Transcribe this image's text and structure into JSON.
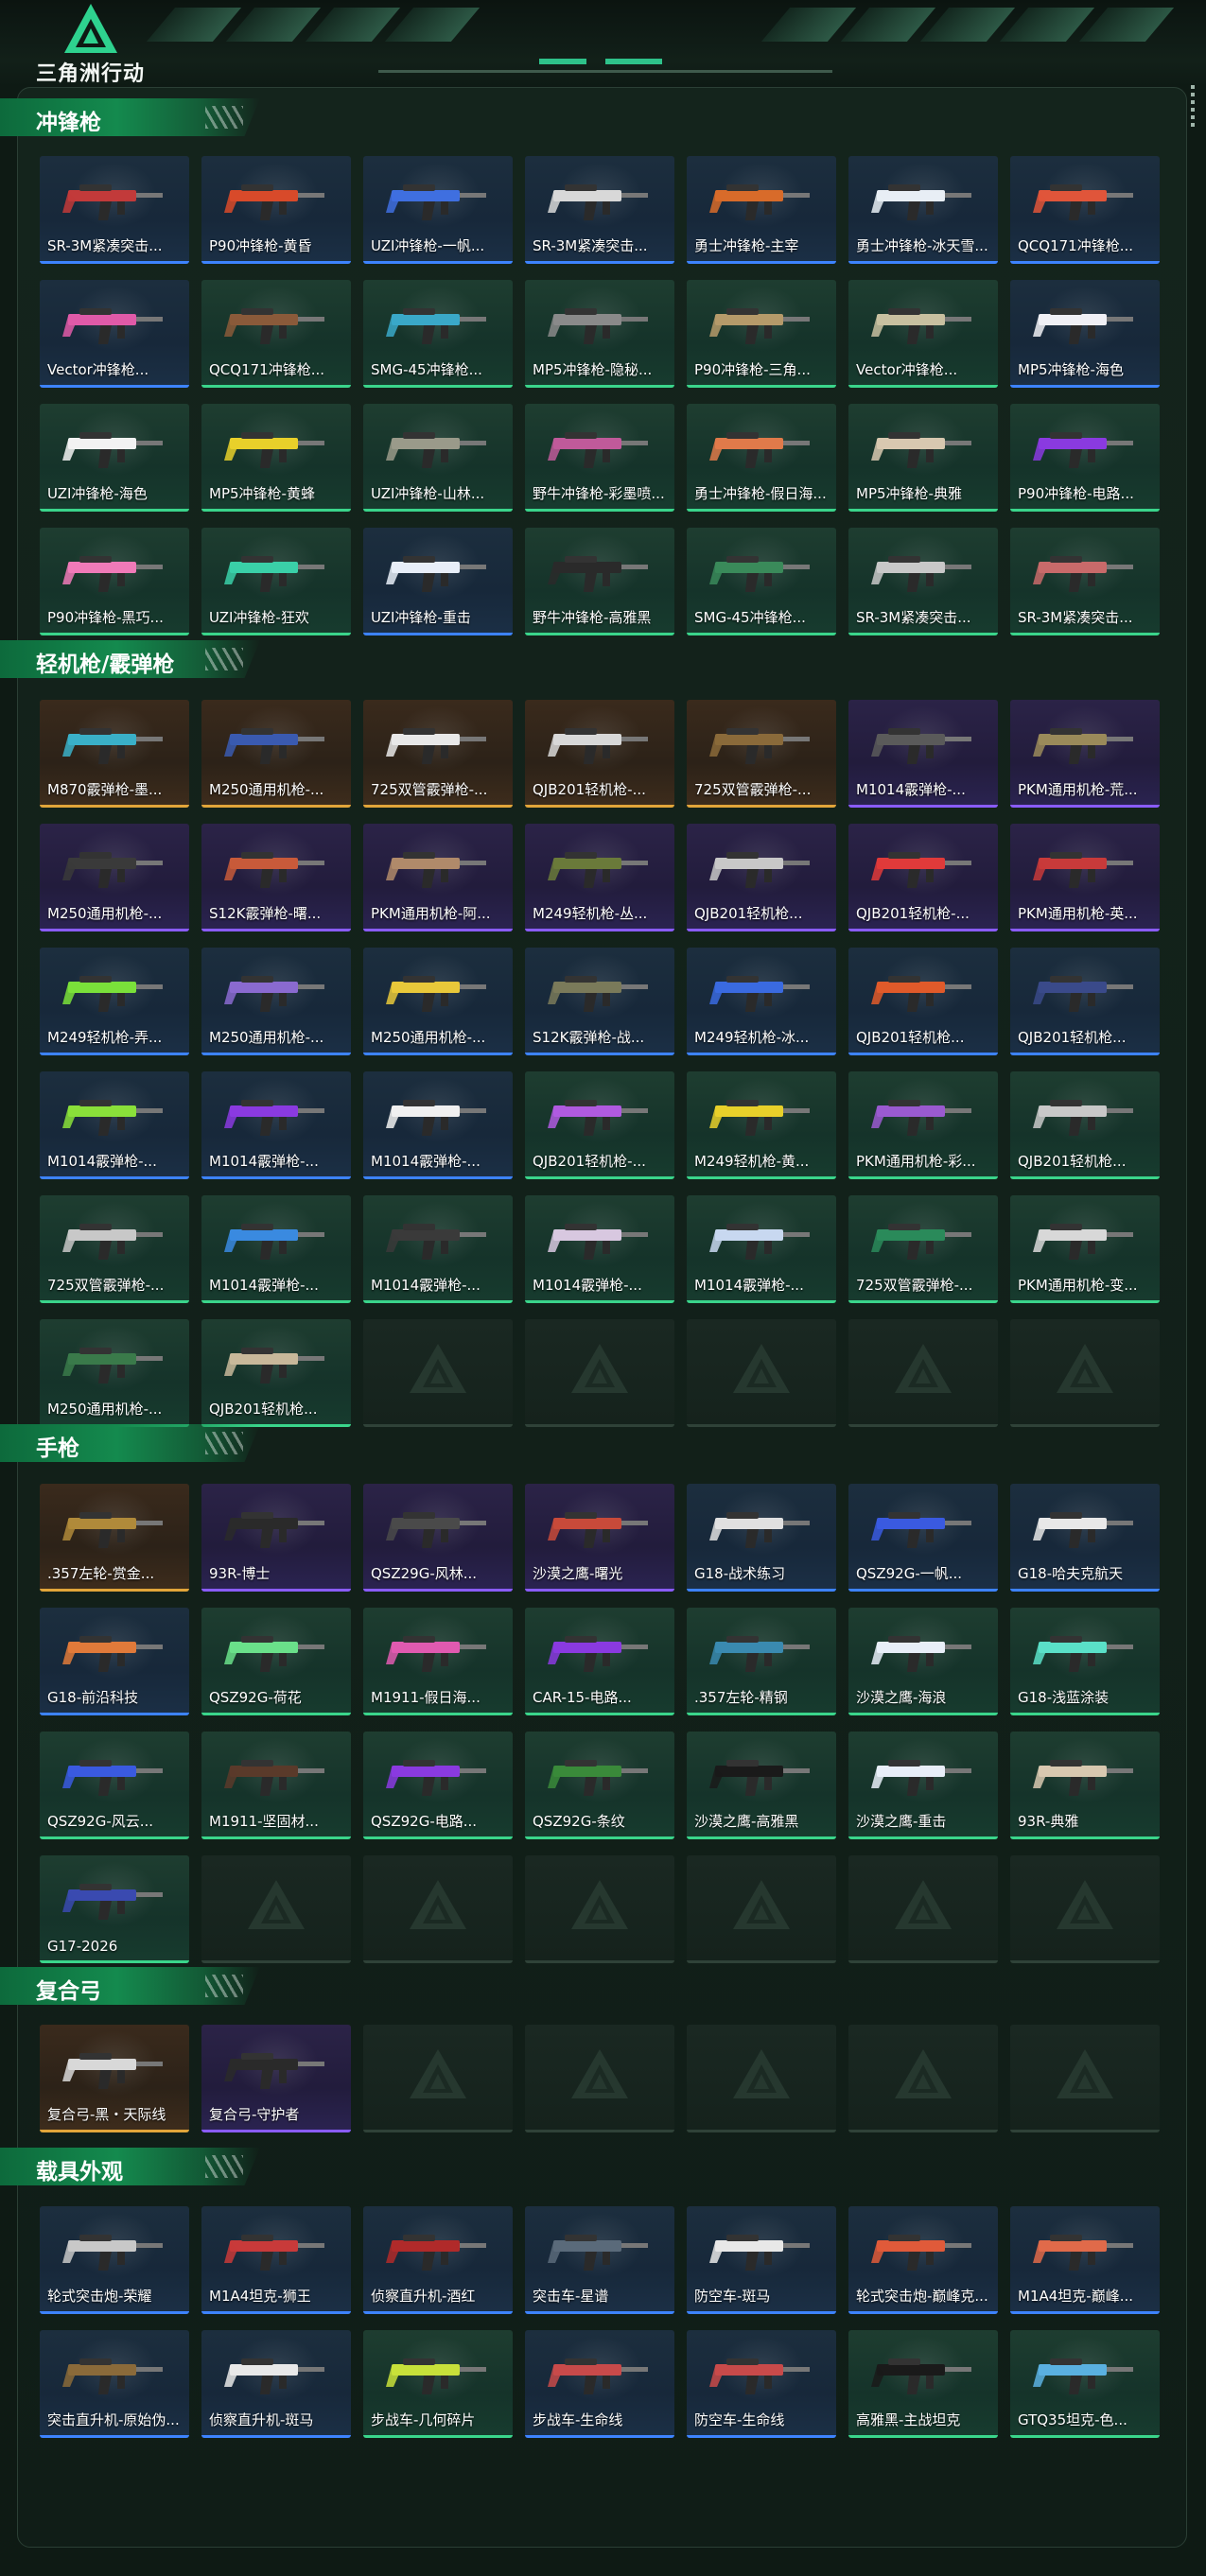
{
  "app": {
    "logo_text": "三角洲行动"
  },
  "colors": {
    "accent": "#148a4e",
    "green_rarity": "#3ad58b",
    "blue_rarity": "#3d83ff",
    "purple_rarity": "#8a5cff",
    "gold_rarity": "#e2a53a"
  },
  "sections": [
    {
      "title": "冲锋枪",
      "items": [
        {
          "label": "SR-3M紧凑突击...",
          "rarity": "blue",
          "c": "#c23a3a"
        },
        {
          "label": "P90冲锋枪-黄昏",
          "rarity": "blue",
          "c": "#d84a2a"
        },
        {
          "label": "UZI冲锋枪-一帆...",
          "rarity": "blue",
          "c": "#3f6fe0"
        },
        {
          "label": "SR-3M紧凑突击...",
          "rarity": "blue",
          "c": "#d8d8d8"
        },
        {
          "label": "勇士冲锋枪-主宰",
          "rarity": "blue",
          "c": "#d86b2a"
        },
        {
          "label": "勇士冲锋枪-冰天雪...",
          "rarity": "blue",
          "c": "#e8eef5"
        },
        {
          "label": "QCQ171冲锋枪...",
          "rarity": "blue",
          "c": "#e0553a"
        },
        {
          "label": "Vector冲锋枪...",
          "rarity": "blue",
          "c": "#e05aa8"
        },
        {
          "label": "QCQ171冲锋枪...",
          "rarity": "green",
          "c": "#8a5a3a"
        },
        {
          "label": "SMG-45冲锋枪...",
          "rarity": "green",
          "c": "#3aa8c8"
        },
        {
          "label": "MP5冲锋枪-隐秘...",
          "rarity": "green",
          "c": "#8a8a8a"
        },
        {
          "label": "P90冲锋枪-三角...",
          "rarity": "green",
          "c": "#b59a6a"
        },
        {
          "label": "Vector冲锋枪...",
          "rarity": "green",
          "c": "#c8c0a0"
        },
        {
          "label": "MP5冲锋枪-海色",
          "rarity": "blue",
          "c": "#f0f0f5"
        },
        {
          "label": "UZI冲锋枪-海色",
          "rarity": "green",
          "c": "#f2f2f2"
        },
        {
          "label": "MP5冲锋枪-黄蜂",
          "rarity": "green",
          "c": "#e8d02a"
        },
        {
          "label": "UZI冲锋枪-山林...",
          "rarity": "green",
          "c": "#9a9a8a"
        },
        {
          "label": "野牛冲锋枪-彩墨喷...",
          "rarity": "green",
          "c": "#c05a9a"
        },
        {
          "label": "勇士冲锋枪-假日海...",
          "rarity": "green",
          "c": "#e07a4a"
        },
        {
          "label": "MP5冲锋枪-典雅",
          "rarity": "green",
          "c": "#d8c8b0"
        },
        {
          "label": "P90冲锋枪-电路...",
          "rarity": "green",
          "c": "#8a3ae0"
        },
        {
          "label": "P90冲锋枪-黑巧...",
          "rarity": "green",
          "c": "#f07ab8"
        },
        {
          "label": "UZI冲锋枪-狂欢",
          "rarity": "green",
          "c": "#3ad0a8"
        },
        {
          "label": "UZI冲锋枪-重击",
          "rarity": "blue",
          "c": "#e8eef8"
        },
        {
          "label": "野牛冲锋枪-高雅黑",
          "rarity": "green",
          "c": "#2a2a2a"
        },
        {
          "label": "SMG-45冲锋枪...",
          "rarity": "green",
          "c": "#3a8a5a"
        },
        {
          "label": "SR-3M紧凑突击...",
          "rarity": "green",
          "c": "#c8c8c8"
        },
        {
          "label": "SR-3M紧凑突击...",
          "rarity": "green",
          "c": "#c86a6a"
        }
      ]
    },
    {
      "title": "轻机枪/霰弹枪",
      "items": [
        {
          "label": "M870霰弹枪-墨...",
          "rarity": "gold",
          "c": "#3ab0c8"
        },
        {
          "label": "M250通用机枪-...",
          "rarity": "gold",
          "c": "#3a5ab0"
        },
        {
          "label": "725双管霰弹枪-...",
          "rarity": "gold",
          "c": "#e8e8e8"
        },
        {
          "label": "QJB201轻机枪-...",
          "rarity": "gold",
          "c": "#d8d8d8"
        },
        {
          "label": "725双管霰弹枪-...",
          "rarity": "gold",
          "c": "#8a6a3a"
        },
        {
          "label": "M1014霰弹枪-...",
          "rarity": "purple",
          "c": "#5a5a5a"
        },
        {
          "label": "PKM通用机枪-荒...",
          "rarity": "purple",
          "c": "#9a8a5a"
        },
        {
          "label": "M250通用机枪-...",
          "rarity": "purple",
          "c": "#3a3a3a"
        },
        {
          "label": "S12K霰弹枪-曙...",
          "rarity": "purple",
          "c": "#c85a3a"
        },
        {
          "label": "PKM通用机枪-阿...",
          "rarity": "purple",
          "c": "#b08a6a"
        },
        {
          "label": "M249轻机枪-丛...",
          "rarity": "purple",
          "c": "#6a7a3a"
        },
        {
          "label": "QJB201轻机枪...",
          "rarity": "purple",
          "c": "#c8c8c8"
        },
        {
          "label": "QJB201轻机枪-...",
          "rarity": "purple",
          "c": "#e03a3a"
        },
        {
          "label": "PKM通用机枪-英...",
          "rarity": "purple",
          "c": "#c83a3a"
        },
        {
          "label": "M249轻机枪-弄...",
          "rarity": "blue",
          "c": "#7ae03a"
        },
        {
          "label": "M250通用机枪-...",
          "rarity": "blue",
          "c": "#8a6ad0"
        },
        {
          "label": "M250通用机枪-...",
          "rarity": "blue",
          "c": "#e8c83a"
        },
        {
          "label": "S12K霰弹枪-战...",
          "rarity": "blue",
          "c": "#7a7a5a"
        },
        {
          "label": "M249轻机枪-冰...",
          "rarity": "blue",
          "c": "#3a6ae0"
        },
        {
          "label": "QJB201轻机枪...",
          "rarity": "blue",
          "c": "#e05a2a"
        },
        {
          "label": "QJB201轻机枪...",
          "rarity": "blue",
          "c": "#3a4a8a"
        },
        {
          "label": "M1014霰弹枪-...",
          "rarity": "blue",
          "c": "#8ae03a"
        },
        {
          "label": "M1014霰弹枪-...",
          "rarity": "blue",
          "c": "#8a3ae0"
        },
        {
          "label": "M1014霰弹枪-...",
          "rarity": "blue",
          "c": "#f0f0f0"
        },
        {
          "label": "QJB201轻机枪-...",
          "rarity": "green",
          "c": "#b05ae0"
        },
        {
          "label": "M249轻机枪-黄...",
          "rarity": "green",
          "c": "#e8d02a"
        },
        {
          "label": "PKM通用机枪-彩...",
          "rarity": "green",
          "c": "#9a5ad0"
        },
        {
          "label": "QJB201轻机枪...",
          "rarity": "green",
          "c": "#c8c8c8"
        },
        {
          "label": "725双管霰弹枪-...",
          "rarity": "green",
          "c": "#c8c8c8"
        },
        {
          "label": "M1014霰弹枪-...",
          "rarity": "green",
          "c": "#3a8ae0"
        },
        {
          "label": "M1014霰弹枪-...",
          "rarity": "green",
          "c": "#3a3a3a"
        },
        {
          "label": "M1014霰弹枪-...",
          "rarity": "green",
          "c": "#d8c8e0"
        },
        {
          "label": "M1014霰弹枪-...",
          "rarity": "green",
          "c": "#c8d8f0"
        },
        {
          "label": "725双管霰弹枪-...",
          "rarity": "green",
          "c": "#2a8a5a"
        },
        {
          "label": "PKM通用机枪-变...",
          "rarity": "green",
          "c": "#d8d8d8"
        },
        {
          "label": "M250通用机枪-...",
          "rarity": "green",
          "c": "#3a7a4a"
        },
        {
          "label": "QJB201轻机枪...",
          "rarity": "green",
          "c": "#c8b89a"
        }
      ],
      "empty_count": 5
    },
    {
      "title": "手枪",
      "items": [
        {
          "label": ".357左轮-赏金...",
          "rarity": "gold",
          "c": "#b08a3a"
        },
        {
          "label": "93R-博士",
          "rarity": "purple",
          "c": "#2a2a2a"
        },
        {
          "label": "QSZ29G-风林...",
          "rarity": "purple",
          "c": "#4a4a4a"
        },
        {
          "label": "沙漠之鹰-曙光",
          "rarity": "purple",
          "c": "#c84a3a"
        },
        {
          "label": "G18-战术练习",
          "rarity": "blue",
          "c": "#e0e0e0"
        },
        {
          "label": "QSZ92G-一帆...",
          "rarity": "blue",
          "c": "#3a5ae0"
        },
        {
          "label": "G18-哈夫克航天",
          "rarity": "blue",
          "c": "#e8e8e8"
        },
        {
          "label": "G18-前沿科技",
          "rarity": "blue",
          "c": "#e07a3a"
        },
        {
          "label": "QSZ92G-荷花",
          "rarity": "green",
          "c": "#6ae08a"
        },
        {
          "label": "M1911-假日海...",
          "rarity": "green",
          "c": "#e05ab0"
        },
        {
          "label": "CAR-15-电路...",
          "rarity": "green",
          "c": "#8a3ae0"
        },
        {
          "label": ".357左轮-精钢",
          "rarity": "green",
          "c": "#3a8ab0"
        },
        {
          "label": "沙漠之鹰-海浪",
          "rarity": "green",
          "c": "#e8eef8"
        },
        {
          "label": "G18-浅蓝涂装",
          "rarity": "green",
          "c": "#5ae0c8"
        },
        {
          "label": "QSZ92G-风云...",
          "rarity": "green",
          "c": "#3a5ae0"
        },
        {
          "label": "M1911-坚固材...",
          "rarity": "green",
          "c": "#5a3a2a"
        },
        {
          "label": "QSZ92G-电路...",
          "rarity": "green",
          "c": "#8a3ae0"
        },
        {
          "label": "QSZ92G-条纹",
          "rarity": "green",
          "c": "#3a8a3a"
        },
        {
          "label": "沙漠之鹰-高雅黑",
          "rarity": "green",
          "c": "#1a1a1a"
        },
        {
          "label": "沙漠之鹰-重击",
          "rarity": "green",
          "c": "#e8eef8"
        },
        {
          "label": "93R-典雅",
          "rarity": "green",
          "c": "#d8c8b0"
        },
        {
          "label": "G17-2026",
          "rarity": "green",
          "c": "#3a4ab0"
        }
      ],
      "empty_count": 6
    },
    {
      "title": "复合弓",
      "items": [
        {
          "label": "复合弓-黑・天际线",
          "rarity": "gold",
          "c": "#d8d8d8"
        },
        {
          "label": "复合弓-守护者",
          "rarity": "purple",
          "c": "#2a2a2a"
        }
      ],
      "empty_count": 5
    },
    {
      "title": "载具外观",
      "items": [
        {
          "label": "轮式突击炮-荣耀",
          "rarity": "blue",
          "c": "#c8c8c8"
        },
        {
          "label": "M1A4坦克-狮王",
          "rarity": "blue",
          "c": "#c83a3a"
        },
        {
          "label": "侦察直升机-酒红",
          "rarity": "blue",
          "c": "#b02a2a"
        },
        {
          "label": "突击车-星谱",
          "rarity": "blue",
          "c": "#5a6a7a"
        },
        {
          "label": "防空车-斑马",
          "rarity": "blue",
          "c": "#e8e8e8"
        },
        {
          "label": "轮式突击炮-巅峰克...",
          "rarity": "blue",
          "c": "#e05a3a"
        },
        {
          "label": "M1A4坦克-巅峰...",
          "rarity": "blue",
          "c": "#e06a4a"
        },
        {
          "label": "突击直升机-原始伪...",
          "rarity": "blue",
          "c": "#8a6a3a"
        },
        {
          "label": "侦察直升机-斑马",
          "rarity": "blue",
          "c": "#e8e8e8"
        },
        {
          "label": "步战车-几何碎片",
          "rarity": "green",
          "c": "#c8e03a"
        },
        {
          "label": "步战车-生命线",
          "rarity": "blue",
          "c": "#c84a4a"
        },
        {
          "label": "防空车-生命线",
          "rarity": "blue",
          "c": "#c84a4a"
        },
        {
          "label": "高雅黑-主战坦克",
          "rarity": "green",
          "c": "#1a1a1a"
        },
        {
          "label": "GTQ35坦克-色...",
          "rarity": "green",
          "c": "#5ab0e0"
        }
      ]
    }
  ]
}
